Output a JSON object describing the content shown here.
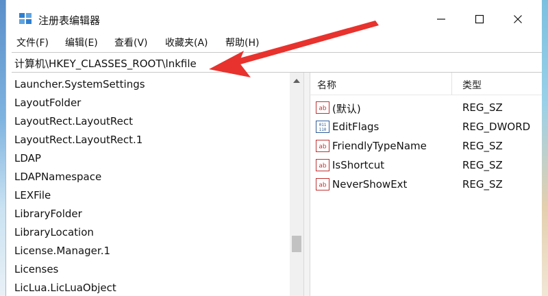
{
  "window": {
    "title": "注册表编辑器",
    "controls": {
      "minimize": "—",
      "maximize": "☐",
      "close": "✕"
    }
  },
  "menu": [
    "文件(F)",
    "编辑(E)",
    "查看(V)",
    "收藏夹(A)",
    "帮助(H)"
  ],
  "address": {
    "path": "计算机\\HKEY_CLASSES_ROOT\\lnkfile"
  },
  "tree": {
    "items": [
      "Launcher.SystemSettings",
      "LayoutFolder",
      "LayoutRect.LayoutRect",
      "LayoutRect.LayoutRect.1",
      "LDAP",
      "LDAPNamespace",
      "LEXFile",
      "LibraryFolder",
      "LibraryLocation",
      "License.Manager.1",
      "Licenses",
      "LicLua.LicLuaObject"
    ]
  },
  "values": {
    "columns": {
      "name": "名称",
      "type": "类型"
    },
    "rows": [
      {
        "name": "(默认)",
        "type": "REG_SZ",
        "icon": "string-value-icon"
      },
      {
        "name": "EditFlags",
        "type": "REG_DWORD",
        "icon": "binary-value-icon"
      },
      {
        "name": "FriendlyTypeName",
        "type": "REG_SZ",
        "icon": "string-value-icon"
      },
      {
        "name": "IsShortcut",
        "type": "REG_SZ",
        "icon": "string-value-icon"
      },
      {
        "name": "NeverShowExt",
        "type": "REG_SZ",
        "icon": "string-value-icon"
      }
    ]
  },
  "annotation": {
    "arrow_color": "#e8322d"
  }
}
